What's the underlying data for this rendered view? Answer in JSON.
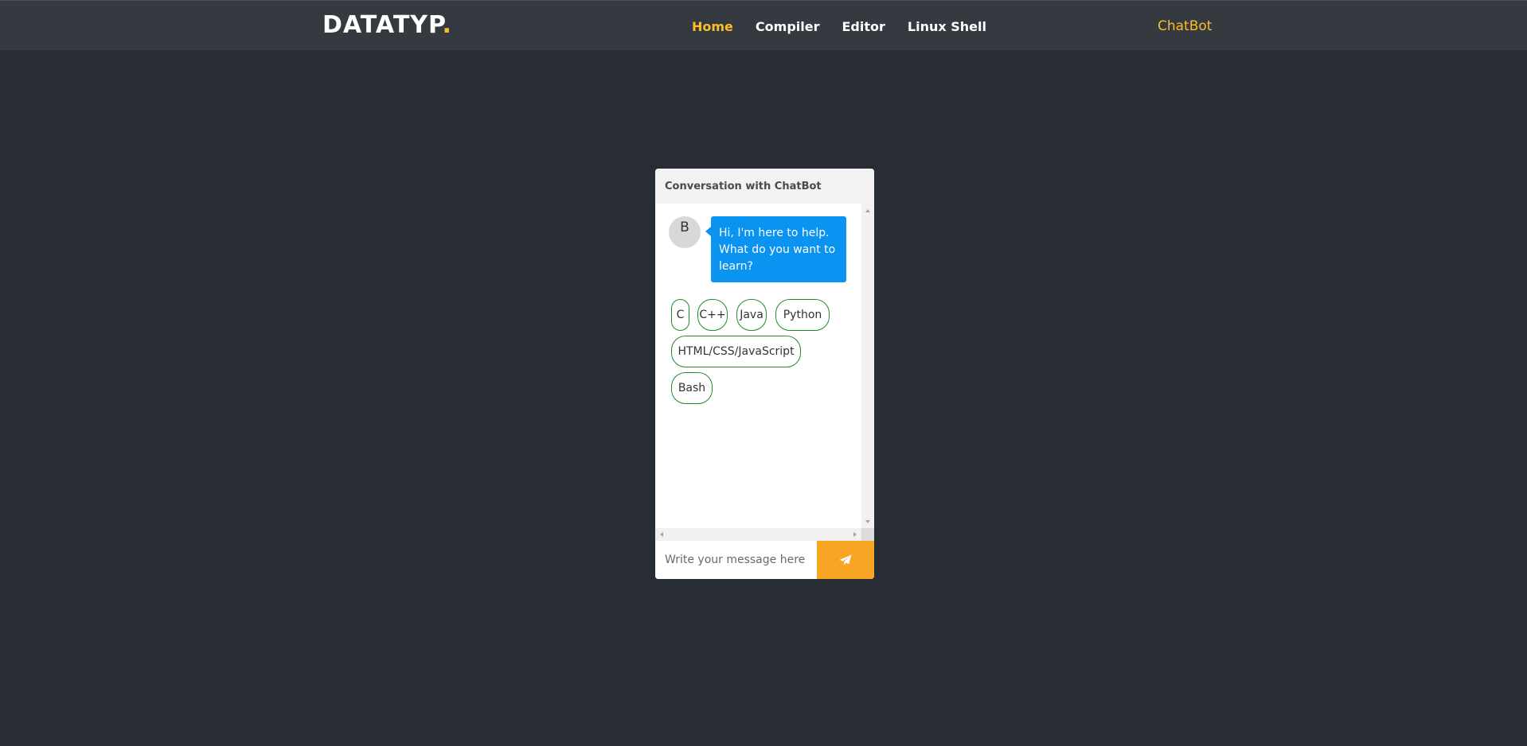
{
  "navbar": {
    "brand": "DATATYP",
    "brand_dot": ".",
    "links": [
      {
        "label": "Home",
        "active": true
      },
      {
        "label": "Compiler",
        "active": false
      },
      {
        "label": "Editor",
        "active": false
      },
      {
        "label": "Linux Shell",
        "active": false
      }
    ],
    "right_link": "ChatBot"
  },
  "chat": {
    "header": "Conversation with ChatBot",
    "bot_avatar": "B",
    "bot_message": "Hi, I'm here to help. What do you want to learn?",
    "options": [
      "C",
      "C++",
      "Java",
      "Python",
      "HTML/CSS/JavaScript",
      "Bash"
    ],
    "input_placeholder": "Write your message here",
    "send_icon": "paper-plane-icon"
  },
  "colors": {
    "background": "#282c34",
    "navbar": "#343a40",
    "accent": "#fcbc2c",
    "bubble": "#0a93f0",
    "option_border": "#1e8c2c",
    "send_button": "#f8a524"
  }
}
